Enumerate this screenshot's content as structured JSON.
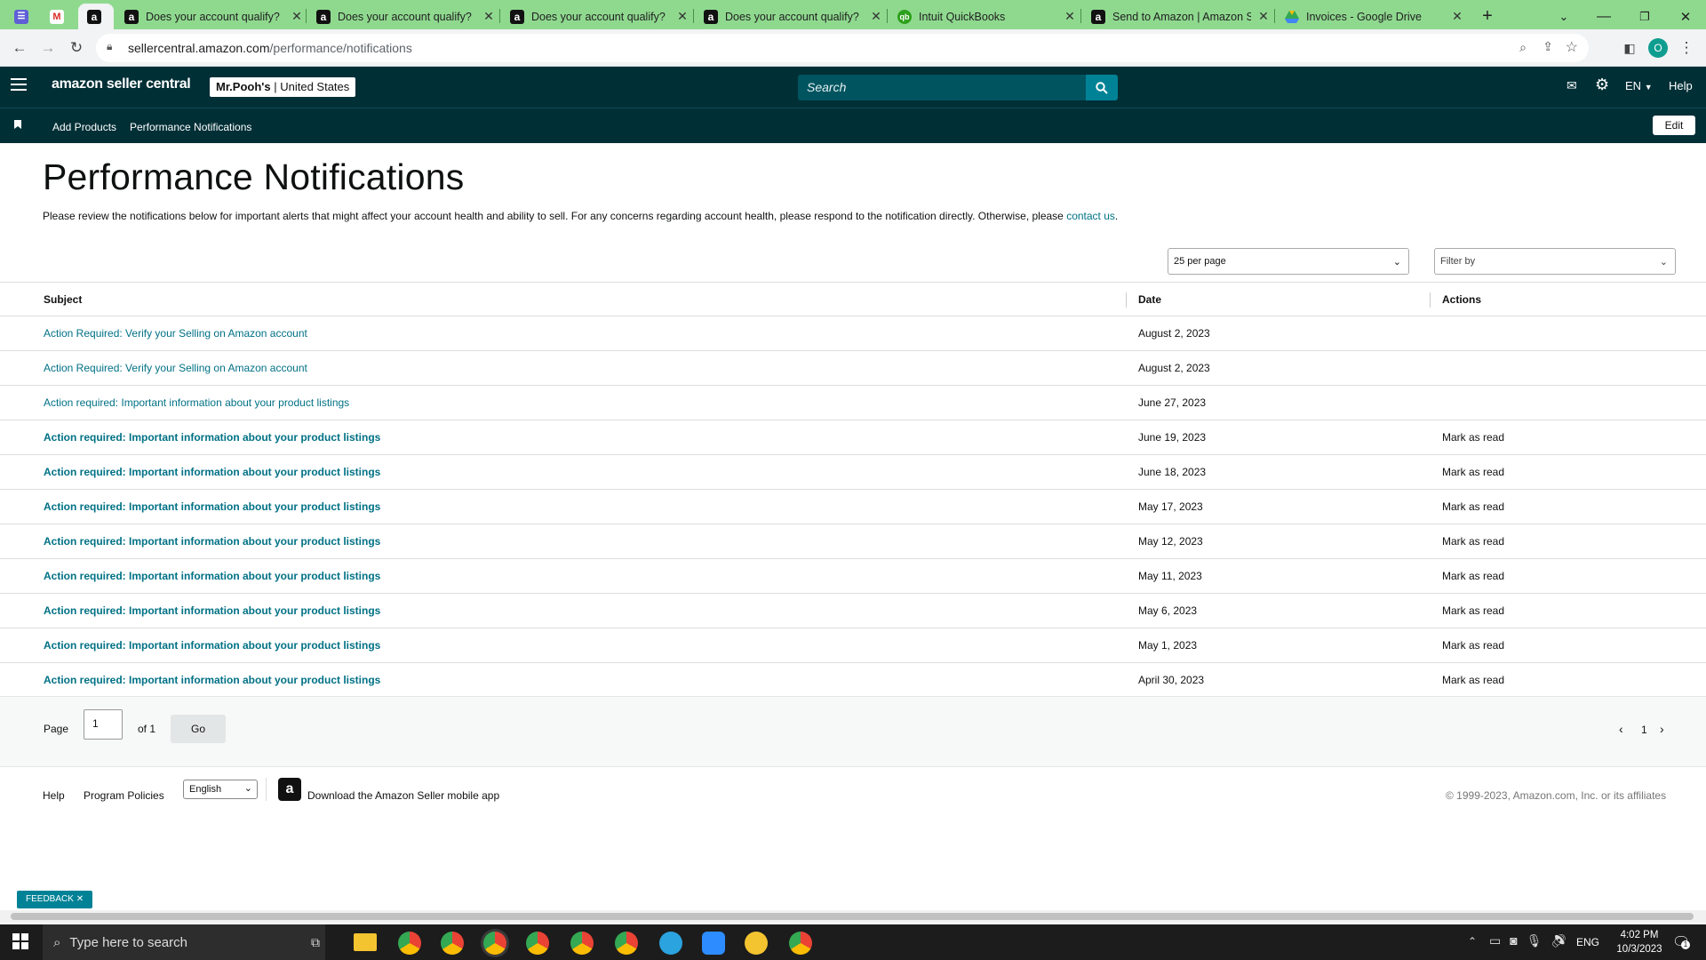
{
  "browser": {
    "tabs": [
      {
        "title": "",
        "icon": "tasks-icon"
      },
      {
        "title": "",
        "icon": "gmail-icon"
      },
      {
        "title": "",
        "icon": "amazon-icon"
      },
      {
        "title": "Does your account qualify?",
        "icon": "amazon-icon"
      },
      {
        "title": "Does your account qualify?",
        "icon": "amazon-icon"
      },
      {
        "title": "Does your account qualify?",
        "icon": "amazon-icon"
      },
      {
        "title": "Does your account qualify?",
        "icon": "amazon-icon"
      },
      {
        "title": "Intuit QuickBooks",
        "icon": "quickbooks-icon"
      },
      {
        "title": "Send to Amazon | Amazon S",
        "icon": "amazon-icon"
      },
      {
        "title": "Invoices - Google Drive",
        "icon": "google-drive-icon"
      }
    ],
    "url_domain": "sellercentral.amazon.com",
    "url_path": "/performance/notifications",
    "profile_initial": "O"
  },
  "header": {
    "logo_text": "amazon seller central",
    "store_name": "Mr.Pooh's",
    "marketplace": "United States",
    "search_placeholder": "Search",
    "language": "EN",
    "help": "Help"
  },
  "nav": {
    "items": [
      "Add Products",
      "Performance Notifications"
    ],
    "edit": "Edit"
  },
  "page": {
    "title": "Performance Notifications",
    "description": "Please review the notifications below for important alerts that might affect your account health and ability to sell. For any concerns regarding account health, please respond to the notification directly. Otherwise, please",
    "contact_link": "contact us",
    "per_page": "25 per page",
    "filter": "Filter by"
  },
  "table": {
    "headers": {
      "subject": "Subject",
      "date": "Date",
      "actions": "Actions"
    },
    "rows": [
      {
        "subject": "Action Required: Verify your Selling on Amazon account",
        "date": "August 2, 2023",
        "action": "",
        "unread": false
      },
      {
        "subject": "Action Required: Verify your Selling on Amazon account",
        "date": "August 2, 2023",
        "action": "",
        "unread": false
      },
      {
        "subject": "Action required: Important information about your product listings",
        "date": "June 27, 2023",
        "action": "",
        "unread": false
      },
      {
        "subject": "Action required: Important information about your product listings",
        "date": "June 19, 2023",
        "action": "Mark as read",
        "unread": true
      },
      {
        "subject": "Action required: Important information about your product listings",
        "date": "June 18, 2023",
        "action": "Mark as read",
        "unread": true
      },
      {
        "subject": "Action required: Important information about your product listings",
        "date": "May 17, 2023",
        "action": "Mark as read",
        "unread": true
      },
      {
        "subject": "Action required: Important information about your product listings",
        "date": "May 12, 2023",
        "action": "Mark as read",
        "unread": true
      },
      {
        "subject": "Action required: Important information about your product listings",
        "date": "May 11, 2023",
        "action": "Mark as read",
        "unread": true
      },
      {
        "subject": "Action required: Important information about your product listings",
        "date": "May 6, 2023",
        "action": "Mark as read",
        "unread": true
      },
      {
        "subject": "Action required: Important information about your product listings",
        "date": "May 1, 2023",
        "action": "Mark as read",
        "unread": true
      },
      {
        "subject": "Action required: Important information about your product listings",
        "date": "April 30, 2023",
        "action": "Mark as read",
        "unread": true
      }
    ]
  },
  "pagination": {
    "page_label": "Page",
    "page_value": "1",
    "of_label": "of 1",
    "go": "Go",
    "current": "1"
  },
  "footer": {
    "help": "Help",
    "program_policies": "Program Policies",
    "language": "English",
    "app_download": "Download the Amazon Seller mobile app",
    "copyright": "© 1999-2023, Amazon.com, Inc. or its affiliates",
    "feedback": "FEEDBACK"
  },
  "taskbar": {
    "search_placeholder": "Type here to search",
    "lang": "ENG",
    "time": "4:02 PM",
    "date": "10/3/2023",
    "notification_count": "1"
  },
  "colors": {
    "header_bg": "#002f36",
    "link": "#007185",
    "tab_strip": "#8fd98f",
    "search_button": "#008296"
  }
}
